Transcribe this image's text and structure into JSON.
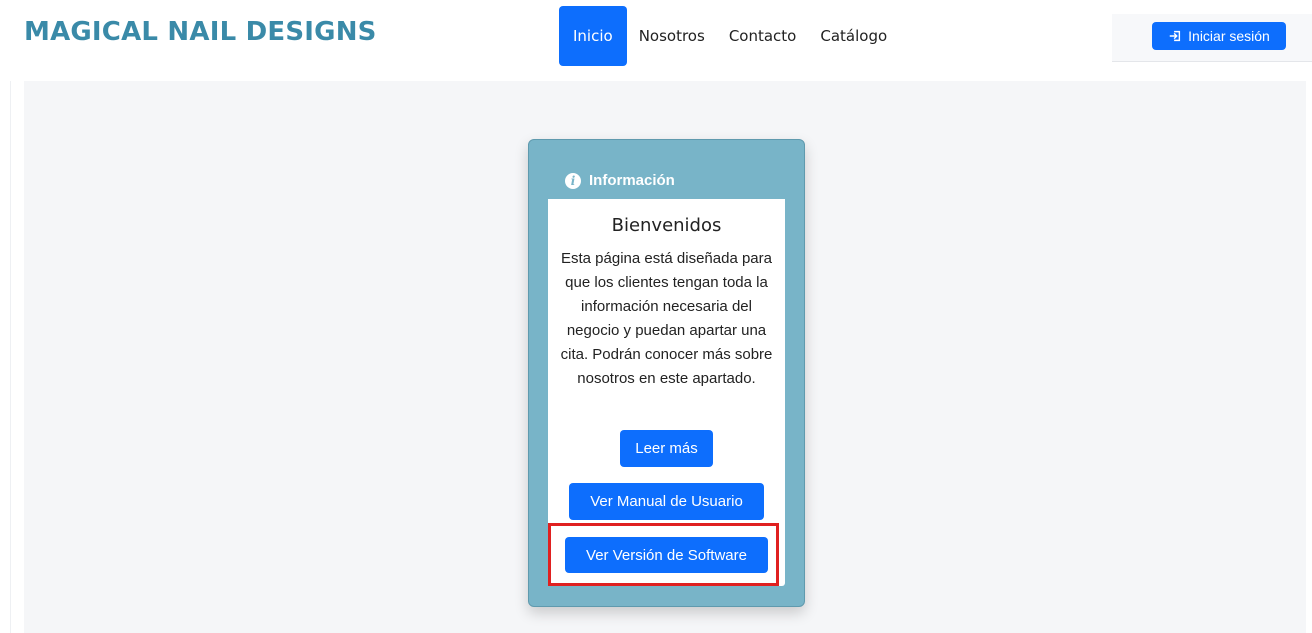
{
  "header": {
    "brand": "MAGICAL NAIL DESIGNS",
    "nav": [
      "Inicio",
      "Nosotros",
      "Contacto",
      "Catálogo"
    ],
    "active_nav": "Inicio",
    "login_label": "Iniciar sesión"
  },
  "card": {
    "header": "Información",
    "title": "Bienvenidos",
    "text": "Esta página está diseñada para que los clientes tengan toda la información necesaria del negocio y puedan apartar una cita. Podrán conocer más sobre nosotros en este apartado.",
    "read_more": "Leer más",
    "manual": "Ver Manual de Usuario",
    "version": "Ver Versión de Software"
  },
  "colors": {
    "brand": "#3a8aa8",
    "primary": "#0d6efd",
    "card_bg": "#78b4c8",
    "highlight": "#e02020"
  },
  "icons": {
    "login": "login-icon",
    "info": "info-icon"
  }
}
